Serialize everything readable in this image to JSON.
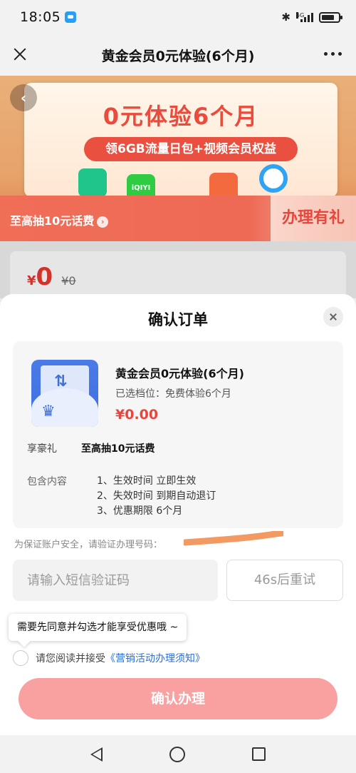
{
  "status_bar": {
    "time": "18:05",
    "network_label": "5G"
  },
  "nav": {
    "title": "黄金会员0元体验(6个月)"
  },
  "banner": {
    "title": "0元体验6个月",
    "subtitle": "领6GB流量日包+视频会员权益",
    "tag_text": "至高抽10元话费",
    "handle_label": "办理有礼",
    "app_logos": [
      "iQIYI"
    ]
  },
  "background_price": {
    "symbol": "¥",
    "value": "0",
    "old_price": "¥0"
  },
  "modal": {
    "title": "确认订单",
    "product": {
      "name": "黄金会员0元体验(6个月)",
      "tier": "已选档位：免费体验6个月",
      "price": "¥0.00"
    },
    "gift_label": "享豪礼",
    "gift_value": "至高抽10元话费",
    "includes_label": "包含内容",
    "includes": [
      "1、生效时间 立即生效",
      "2、失效时间 到期自动退订",
      "3、优惠期限 6个月"
    ],
    "verify_note": "为保证账户安全，请验证办理号码：",
    "code_placeholder": "请输入短信验证码",
    "resend_label": "46s后重试",
    "tooltip": "需要先同意并勾选才能享受优惠哦 ~",
    "agree_text": "请您阅读并接受",
    "agree_link": "《营销活动办理须知》",
    "confirm_label": "确认办理"
  },
  "colors": {
    "accent_red": "#e8453c",
    "confirm_button": "#f8a1a0",
    "link_blue": "#2a6fd6"
  }
}
